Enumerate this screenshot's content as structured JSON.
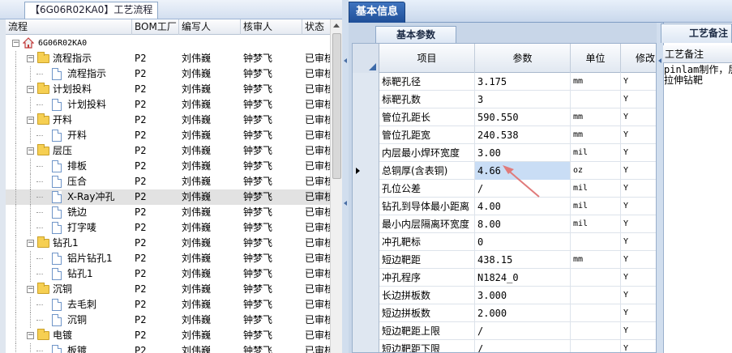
{
  "left_tab": {
    "label": "【6G06R02KA0】工艺流程"
  },
  "tree": {
    "columns": [
      "流程",
      "BOM工厂",
      "编写人",
      "核审人",
      "状态"
    ],
    "rows": [
      {
        "level": 0,
        "icon": "home",
        "expander": "-",
        "name": "6G06R02KA0",
        "bom": "",
        "writer": "",
        "reviewer": "",
        "status": ""
      },
      {
        "level": 1,
        "icon": "folder",
        "expander": "-",
        "name": "流程指示",
        "bom": "P2",
        "writer": "刘伟巍",
        "reviewer": "钟梦飞",
        "status": "已审核"
      },
      {
        "level": 2,
        "icon": "doc",
        "name": "流程指示",
        "bom": "P2",
        "writer": "刘伟巍",
        "reviewer": "钟梦飞",
        "status": "已审核"
      },
      {
        "level": 1,
        "icon": "folder",
        "expander": "-",
        "name": "计划投料",
        "bom": "P2",
        "writer": "刘伟巍",
        "reviewer": "钟梦飞",
        "status": "已审核"
      },
      {
        "level": 2,
        "icon": "doc",
        "name": "计划投料",
        "bom": "P2",
        "writer": "刘伟巍",
        "reviewer": "钟梦飞",
        "status": "已审核"
      },
      {
        "level": 1,
        "icon": "folder",
        "expander": "-",
        "name": "开料",
        "bom": "P2",
        "writer": "刘伟巍",
        "reviewer": "钟梦飞",
        "status": "已审核"
      },
      {
        "level": 2,
        "icon": "doc",
        "name": "开料",
        "bom": "P2",
        "writer": "刘伟巍",
        "reviewer": "钟梦飞",
        "status": "已审核"
      },
      {
        "level": 1,
        "icon": "folder",
        "expander": "-",
        "name": "层压",
        "bom": "P2",
        "writer": "刘伟巍",
        "reviewer": "钟梦飞",
        "status": "已审核"
      },
      {
        "level": 2,
        "icon": "doc",
        "name": "排板",
        "bom": "P2",
        "writer": "刘伟巍",
        "reviewer": "钟梦飞",
        "status": "已审核"
      },
      {
        "level": 2,
        "icon": "doc",
        "name": "压合",
        "bom": "P2",
        "writer": "刘伟巍",
        "reviewer": "钟梦飞",
        "status": "已审核"
      },
      {
        "level": 2,
        "icon": "doc",
        "name": "X-Ray冲孔",
        "bom": "P2",
        "writer": "刘伟巍",
        "reviewer": "钟梦飞",
        "status": "已审核",
        "selected": true
      },
      {
        "level": 2,
        "icon": "doc",
        "name": "铣边",
        "bom": "P2",
        "writer": "刘伟巍",
        "reviewer": "钟梦飞",
        "status": "已审核"
      },
      {
        "level": 2,
        "icon": "doc",
        "name": "打字唛",
        "bom": "P2",
        "writer": "刘伟巍",
        "reviewer": "钟梦飞",
        "status": "已审核"
      },
      {
        "level": 1,
        "icon": "folder",
        "expander": "-",
        "name": "钻孔1",
        "bom": "P2",
        "writer": "刘伟巍",
        "reviewer": "钟梦飞",
        "status": "已审核"
      },
      {
        "level": 2,
        "icon": "doc",
        "name": "铝片钻孔1",
        "bom": "P2",
        "writer": "刘伟巍",
        "reviewer": "钟梦飞",
        "status": "已审核"
      },
      {
        "level": 2,
        "icon": "doc",
        "name": "钻孔1",
        "bom": "P2",
        "writer": "刘伟巍",
        "reviewer": "钟梦飞",
        "status": "已审核"
      },
      {
        "level": 1,
        "icon": "folder",
        "expander": "-",
        "name": "沉铜",
        "bom": "P2",
        "writer": "刘伟巍",
        "reviewer": "钟梦飞",
        "status": "已审核"
      },
      {
        "level": 2,
        "icon": "doc",
        "name": "去毛刺",
        "bom": "P2",
        "writer": "刘伟巍",
        "reviewer": "钟梦飞",
        "status": "已审核"
      },
      {
        "level": 2,
        "icon": "doc",
        "name": "沉铜",
        "bom": "P2",
        "writer": "刘伟巍",
        "reviewer": "钟梦飞",
        "status": "已审核"
      },
      {
        "level": 1,
        "icon": "folder",
        "expander": "-",
        "name": "电镀",
        "bom": "P2",
        "writer": "刘伟巍",
        "reviewer": "钟梦飞",
        "status": "已审核"
      },
      {
        "level": 2,
        "icon": "doc",
        "name": "板镀",
        "bom": "P2",
        "writer": "刘伟巍",
        "reviewer": "钟梦飞",
        "status": "已审核"
      }
    ]
  },
  "mid": {
    "main_tab": "基本信息",
    "sub_tab": "基本参数",
    "columns": [
      "项目",
      "参数",
      "单位",
      "修改"
    ],
    "rows": [
      {
        "item": "标靶孔径",
        "value": "3.175",
        "unit": "mm",
        "mod": "Y"
      },
      {
        "item": "标靶孔数",
        "value": "3",
        "unit": "",
        "mod": "Y"
      },
      {
        "item": "管位孔距长",
        "value": "590.550",
        "unit": "mm",
        "mod": "Y"
      },
      {
        "item": "管位孔距宽",
        "value": "240.538",
        "unit": "mm",
        "mod": "Y"
      },
      {
        "item": "内层最小焊环宽度",
        "value": "3.00",
        "unit": "mil",
        "mod": "Y"
      },
      {
        "item": "总铜厚(含表铜)",
        "value": "4.66",
        "unit": "oz",
        "mod": "Y",
        "current": true
      },
      {
        "item": "孔位公差",
        "value": "/",
        "unit": "mil",
        "mod": "Y"
      },
      {
        "item": "钻孔到导体最小距离",
        "value": "4.00",
        "unit": "mil",
        "mod": "Y"
      },
      {
        "item": "最小内层隔离环宽度",
        "value": "8.00",
        "unit": "mil",
        "mod": "Y"
      },
      {
        "item": "冲孔靶标",
        "value": "0",
        "unit": "",
        "mod": "Y"
      },
      {
        "item": "短边靶距",
        "value": "438.15",
        "unit": "mm",
        "mod": "Y"
      },
      {
        "item": "冲孔程序",
        "value": "N1824_0",
        "unit": "",
        "mod": "Y"
      },
      {
        "item": "长边拼板数",
        "value": "3.000",
        "unit": "",
        "mod": "Y"
      },
      {
        "item": "短边拼板数",
        "value": "2.000",
        "unit": "",
        "mod": "Y"
      },
      {
        "item": "短边靶距上限",
        "value": "/",
        "unit": "",
        "mod": "Y"
      },
      {
        "item": "短边靶距下限",
        "value": "/",
        "unit": "",
        "mod": "Y"
      }
    ]
  },
  "right": {
    "tab": "工艺备注",
    "header": "工艺备注",
    "text_line1": "pinlam制作，层",
    "text_line2": "拉伸钻靶"
  },
  "colors": {
    "accent": "#1f4f98",
    "highlight": "#c9ddf5",
    "arrow": "#e07a7a"
  }
}
